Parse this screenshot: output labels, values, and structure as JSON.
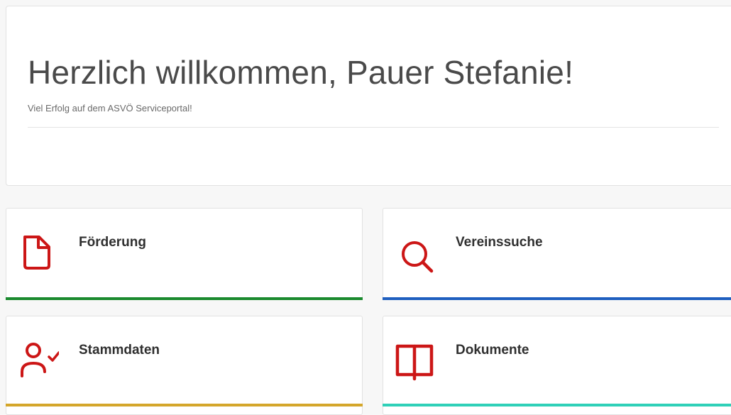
{
  "welcome": {
    "title": "Herzlich willkommen, Pauer Stefanie!",
    "subtitle": "Viel Erfolg auf dem ASVÖ Serviceportal!"
  },
  "icon_color": "#cc1616",
  "tiles": [
    {
      "label": "Förderung",
      "icon": "document-icon",
      "accent_color": "#1a8a2e"
    },
    {
      "label": "Vereinssuche",
      "icon": "search-icon",
      "accent_color": "#1f5fbf"
    },
    {
      "label": "Stammdaten",
      "icon": "user-check-icon",
      "accent_color": "#d4a62a"
    },
    {
      "label": "Dokumente",
      "icon": "open-book-icon",
      "accent_color": "#2fd0b8"
    }
  ]
}
